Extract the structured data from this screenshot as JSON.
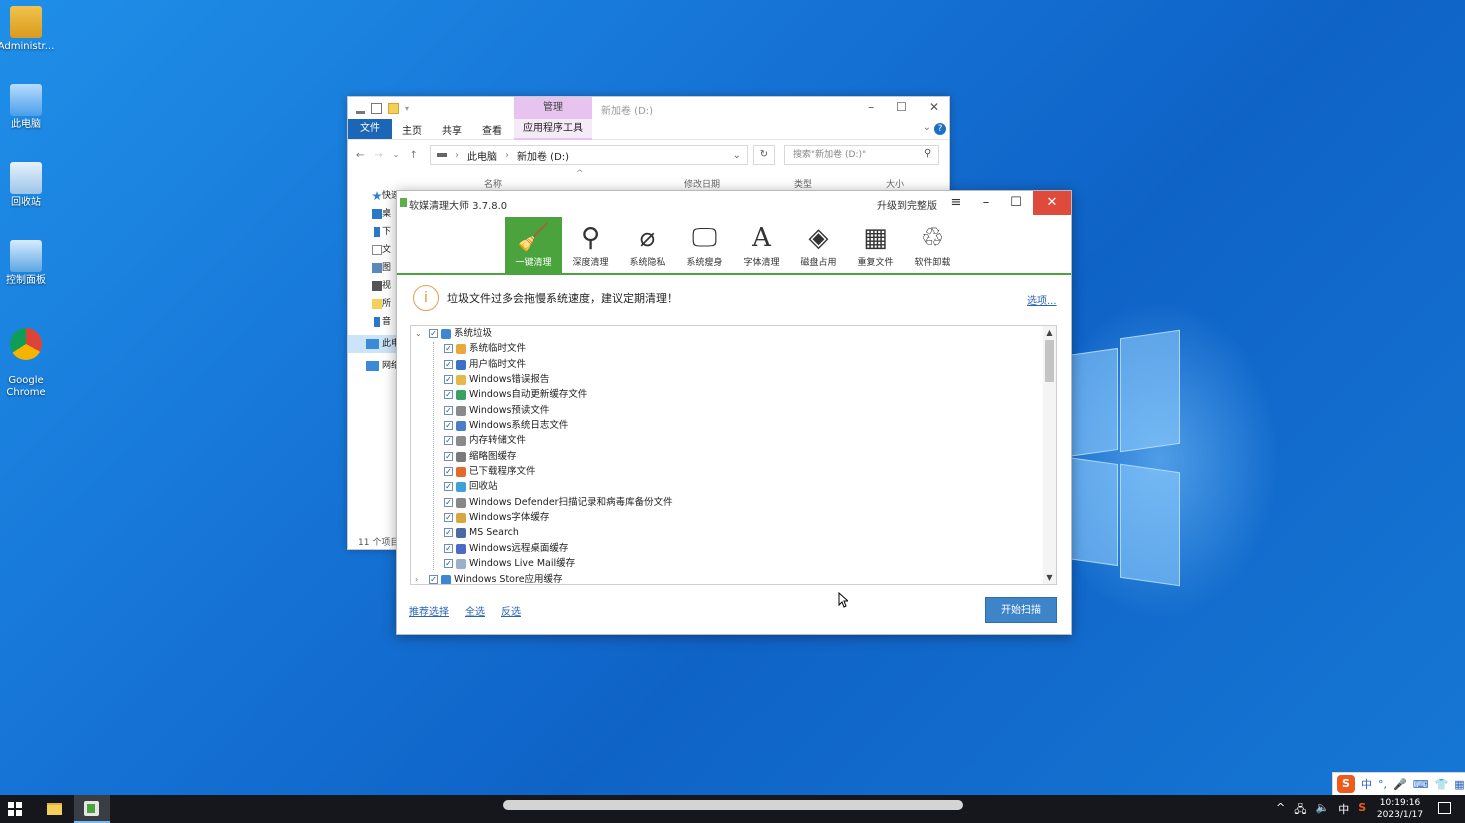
{
  "desktop": {
    "icons": [
      {
        "label": "Administr...",
        "icon": "user-folder-icon"
      },
      {
        "label": "此电脑",
        "icon": "computer-icon"
      },
      {
        "label": "回收站",
        "icon": "recycle-bin-icon"
      },
      {
        "label": "控制面板",
        "icon": "control-panel-icon"
      },
      {
        "label": "Google\nChrome",
        "icon": "chrome-icon"
      }
    ]
  },
  "explorer": {
    "manage_tab": "管理",
    "window_title": "新加卷 (D:)",
    "ribbon": {
      "file": "文件",
      "home": "主页",
      "share": "共享",
      "view": "查看",
      "app_tools": "应用程序工具"
    },
    "breadcrumb": [
      "此电脑",
      "新加卷 (D:)"
    ],
    "search_placeholder": "搜索\"新加卷 (D:)\"",
    "columns": {
      "name": "名称",
      "modified": "修改日期",
      "type": "类型",
      "size": "大小"
    },
    "sidebar": [
      {
        "label": "快速",
        "icon": "star-icon"
      },
      {
        "label": "桌",
        "icon": "desktop-icon"
      },
      {
        "label": "下",
        "icon": "download-icon"
      },
      {
        "label": "文",
        "icon": "document-icon"
      },
      {
        "label": "图",
        "icon": "picture-icon"
      },
      {
        "label": "视",
        "icon": "video-icon"
      },
      {
        "label": "所",
        "icon": "folder-icon"
      },
      {
        "label": "音",
        "icon": "music-icon"
      },
      {
        "label": "此电",
        "icon": "computer-icon"
      },
      {
        "label": "网络",
        "icon": "network-icon"
      }
    ],
    "status": "11 个项目"
  },
  "cleaner": {
    "title": "软媒清理大师 3.7.8.0",
    "upgrade": "升级到完整版",
    "tools": [
      {
        "label": "一键清理",
        "glyph": "🧹",
        "active": true
      },
      {
        "label": "深度清理",
        "glyph": "⚲",
        "active": false
      },
      {
        "label": "系统隐私",
        "glyph": "⌀",
        "active": false
      },
      {
        "label": "系统瘦身",
        "glyph": "🖵",
        "active": false
      },
      {
        "label": "字体清理",
        "glyph": "A",
        "active": false
      },
      {
        "label": "磁盘占用",
        "glyph": "◈",
        "active": false
      },
      {
        "label": "重复文件",
        "glyph": "▦",
        "active": false
      },
      {
        "label": "软件卸载",
        "glyph": "♲",
        "active": false
      }
    ],
    "tip": "垃圾文件过多会拖慢系统速度，建议定期清理！",
    "options_link": "选项...",
    "tree": [
      {
        "label": "系统垃圾",
        "level": 0,
        "expanded": true,
        "color": "#3d86d3"
      },
      {
        "label": "系统临时文件",
        "level": 1,
        "color": "#e8a93a"
      },
      {
        "label": "用户临时文件",
        "level": 1,
        "color": "#3d6fc6"
      },
      {
        "label": "Windows错误报告",
        "level": 1,
        "color": "#e5b84a"
      },
      {
        "label": "Windows自动更新缓存文件",
        "level": 1,
        "color": "#3aa260"
      },
      {
        "label": "Windows预读文件",
        "level": 1,
        "color": "#8a8a8a"
      },
      {
        "label": "Windows系统日志文件",
        "level": 1,
        "color": "#4a7fc6"
      },
      {
        "label": "内存转储文件",
        "level": 1,
        "color": "#8a8a8a"
      },
      {
        "label": "缩略图缓存",
        "level": 1,
        "color": "#7a7a7a"
      },
      {
        "label": "已下载程序文件",
        "level": 1,
        "color": "#e36a2a"
      },
      {
        "label": "回收站",
        "level": 1,
        "color": "#3da2d8"
      },
      {
        "label": "Windows Defender扫描记录和病毒库备份文件",
        "level": 1,
        "color": "#888888"
      },
      {
        "label": "Windows字体缓存",
        "level": 1,
        "color": "#d9a640"
      },
      {
        "label": "MS Search",
        "level": 1,
        "color": "#4a6aa0"
      },
      {
        "label": "Windows远程桌面缓存",
        "level": 1,
        "color": "#4a6ac6"
      },
      {
        "label": "Windows Live Mail缓存",
        "level": 1,
        "color": "#9ab0c8"
      },
      {
        "label": "Windows Store应用缓存",
        "level": 0,
        "expanded": false,
        "color": "#3d86d3"
      }
    ],
    "links": {
      "recommended": "推荐选择",
      "select_all": "全选",
      "invert": "反选"
    },
    "scan_button": "开始扫描"
  },
  "taskbar": {
    "ime_label": "中",
    "tray_lang": "中",
    "time": "10:19:16",
    "date": "2023/1/17"
  }
}
